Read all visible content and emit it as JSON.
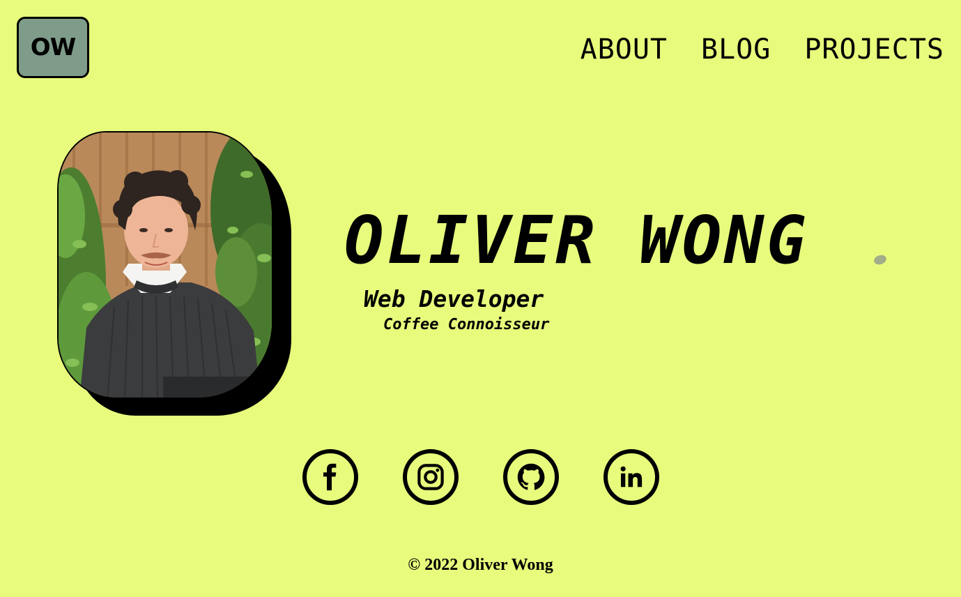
{
  "header": {
    "logo_text": "OW",
    "nav": [
      {
        "label": "ABOUT"
      },
      {
        "label": "BLOG"
      },
      {
        "label": "PROJECTS"
      }
    ]
  },
  "hero": {
    "name": "OLIVER WONG",
    "role": "Web Developer",
    "subrole": "Coffee Connoisseur",
    "photo_icon": "profile-photo"
  },
  "social": [
    {
      "icon": "facebook-icon"
    },
    {
      "icon": "instagram-icon"
    },
    {
      "icon": "github-icon"
    },
    {
      "icon": "linkedin-icon"
    }
  ],
  "footer": {
    "copyright": "© 2022 Oliver Wong"
  },
  "colors": {
    "background": "#e8fb7c",
    "logo_bg": "#7f9c8a",
    "accent_dot": "#a3ac88",
    "ink": "#000000"
  }
}
